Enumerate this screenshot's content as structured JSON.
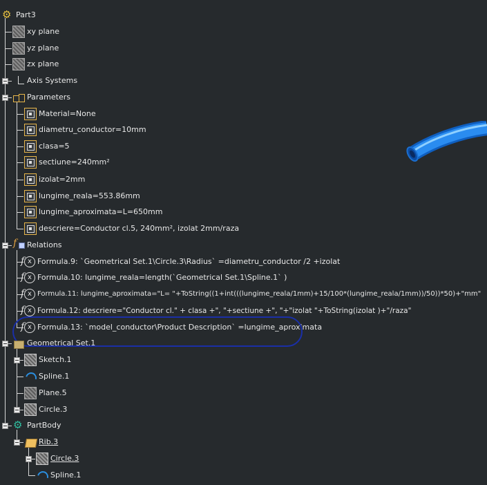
{
  "tree": {
    "root": "Part3",
    "planes": [
      "xy plane",
      "yz plane",
      "zx plane"
    ],
    "axis_systems": "Axis Systems",
    "parameters": {
      "label": "Parameters",
      "items": [
        "Material=None",
        "diametru_conductor=10mm",
        "clasa=5",
        "sectiune=240mm²",
        "izolat=2mm",
        "lungime_reala=553.86mm",
        "lungime_aproximata=L=650mm",
        "descriere=Conductor cl.5, 240mm², izolat 2mm/raza"
      ]
    },
    "relations": {
      "label": "Relations",
      "items": [
        "Formula.9: `Geometrical Set.1\\Circle.3\\Radius` =diametru_conductor /2 +izolat",
        "Formula.10: lungime_reala=length(`Geometrical Set.1\\Spline.1` )",
        "Formula.11: lungime_aproximata=\"L= \"+ToString((1+int(((lungime_reala/1mm)+15/100*(lungime_reala/1mm))/50))*50)+\"mm\"",
        "Formula.12: descriere=\"Conductor cl.\" + clasa +\", \"+sectiune +\", \"+\"izolat \"+ToString(izolat )+\"/raza\"",
        "Formula.13: `model_conductor\\Product Description` =lungime_aproximata"
      ]
    },
    "geometrical_set": {
      "label": "Geometrical Set.1",
      "items": [
        "Sketch.1",
        "Spline.1",
        "Plane.5",
        "Circle.3"
      ]
    },
    "part_body": {
      "label": "PartBody",
      "rib": "Rib.3",
      "rib_children": [
        "Circle.3",
        "Spline.1"
      ]
    }
  },
  "colors": {
    "background": "#262a2d",
    "highlight_ellipse": "#1a2fa8",
    "tube": "#1e7fe8"
  }
}
